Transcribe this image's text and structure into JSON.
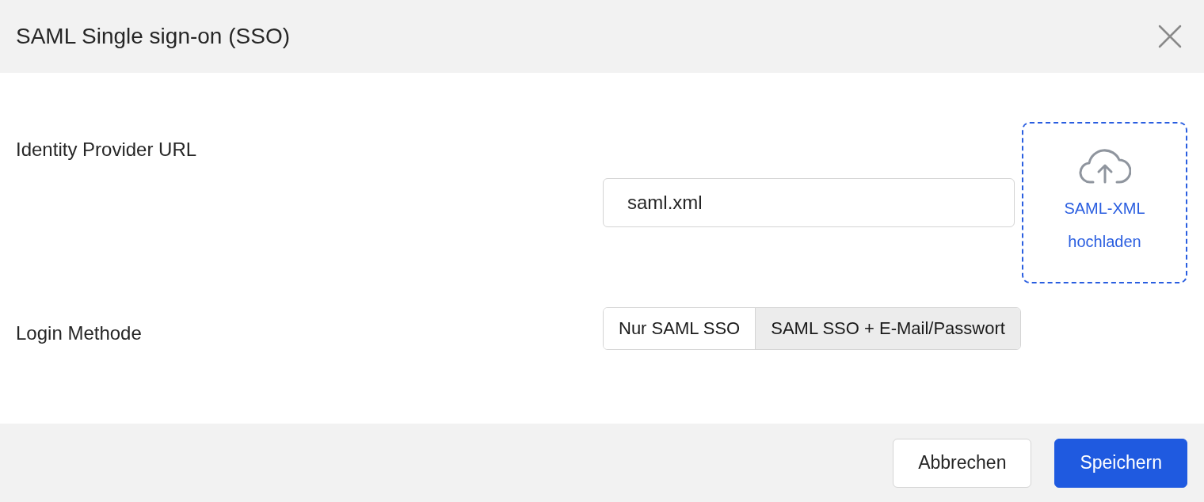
{
  "title": "SAML Single sign-on (SSO)",
  "identity_provider": {
    "label": "Identity Provider URL",
    "value": "saml.xml",
    "upload": "SAML-XML hochladen"
  },
  "login_method": {
    "label": "Login Methode",
    "options": [
      {
        "label": "Nur SAML SSO",
        "selected": false
      },
      {
        "label": "SAML SSO + E-Mail/Passwort",
        "selected": true
      }
    ]
  },
  "buttons": [
    {
      "label": "Abbrechen",
      "kind": "secondary"
    },
    {
      "label": "Speichern",
      "kind": "primary"
    }
  ]
}
